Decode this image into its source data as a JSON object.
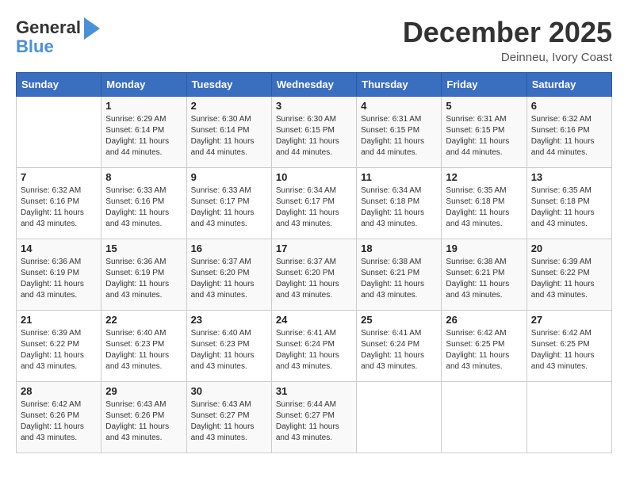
{
  "header": {
    "logo_line1": "General",
    "logo_line2": "Blue",
    "month": "December 2025",
    "location": "Deinneu, Ivory Coast"
  },
  "days_of_week": [
    "Sunday",
    "Monday",
    "Tuesday",
    "Wednesday",
    "Thursday",
    "Friday",
    "Saturday"
  ],
  "weeks": [
    [
      {
        "num": "",
        "sunrise": "",
        "sunset": "",
        "daylight": ""
      },
      {
        "num": "1",
        "sunrise": "Sunrise: 6:29 AM",
        "sunset": "Sunset: 6:14 PM",
        "daylight": "Daylight: 11 hours and 44 minutes."
      },
      {
        "num": "2",
        "sunrise": "Sunrise: 6:30 AM",
        "sunset": "Sunset: 6:14 PM",
        "daylight": "Daylight: 11 hours and 44 minutes."
      },
      {
        "num": "3",
        "sunrise": "Sunrise: 6:30 AM",
        "sunset": "Sunset: 6:15 PM",
        "daylight": "Daylight: 11 hours and 44 minutes."
      },
      {
        "num": "4",
        "sunrise": "Sunrise: 6:31 AM",
        "sunset": "Sunset: 6:15 PM",
        "daylight": "Daylight: 11 hours and 44 minutes."
      },
      {
        "num": "5",
        "sunrise": "Sunrise: 6:31 AM",
        "sunset": "Sunset: 6:15 PM",
        "daylight": "Daylight: 11 hours and 44 minutes."
      },
      {
        "num": "6",
        "sunrise": "Sunrise: 6:32 AM",
        "sunset": "Sunset: 6:16 PM",
        "daylight": "Daylight: 11 hours and 44 minutes."
      }
    ],
    [
      {
        "num": "7",
        "sunrise": "Sunrise: 6:32 AM",
        "sunset": "Sunset: 6:16 PM",
        "daylight": "Daylight: 11 hours and 43 minutes."
      },
      {
        "num": "8",
        "sunrise": "Sunrise: 6:33 AM",
        "sunset": "Sunset: 6:16 PM",
        "daylight": "Daylight: 11 hours and 43 minutes."
      },
      {
        "num": "9",
        "sunrise": "Sunrise: 6:33 AM",
        "sunset": "Sunset: 6:17 PM",
        "daylight": "Daylight: 11 hours and 43 minutes."
      },
      {
        "num": "10",
        "sunrise": "Sunrise: 6:34 AM",
        "sunset": "Sunset: 6:17 PM",
        "daylight": "Daylight: 11 hours and 43 minutes."
      },
      {
        "num": "11",
        "sunrise": "Sunrise: 6:34 AM",
        "sunset": "Sunset: 6:18 PM",
        "daylight": "Daylight: 11 hours and 43 minutes."
      },
      {
        "num": "12",
        "sunrise": "Sunrise: 6:35 AM",
        "sunset": "Sunset: 6:18 PM",
        "daylight": "Daylight: 11 hours and 43 minutes."
      },
      {
        "num": "13",
        "sunrise": "Sunrise: 6:35 AM",
        "sunset": "Sunset: 6:18 PM",
        "daylight": "Daylight: 11 hours and 43 minutes."
      }
    ],
    [
      {
        "num": "14",
        "sunrise": "Sunrise: 6:36 AM",
        "sunset": "Sunset: 6:19 PM",
        "daylight": "Daylight: 11 hours and 43 minutes."
      },
      {
        "num": "15",
        "sunrise": "Sunrise: 6:36 AM",
        "sunset": "Sunset: 6:19 PM",
        "daylight": "Daylight: 11 hours and 43 minutes."
      },
      {
        "num": "16",
        "sunrise": "Sunrise: 6:37 AM",
        "sunset": "Sunset: 6:20 PM",
        "daylight": "Daylight: 11 hours and 43 minutes."
      },
      {
        "num": "17",
        "sunrise": "Sunrise: 6:37 AM",
        "sunset": "Sunset: 6:20 PM",
        "daylight": "Daylight: 11 hours and 43 minutes."
      },
      {
        "num": "18",
        "sunrise": "Sunrise: 6:38 AM",
        "sunset": "Sunset: 6:21 PM",
        "daylight": "Daylight: 11 hours and 43 minutes."
      },
      {
        "num": "19",
        "sunrise": "Sunrise: 6:38 AM",
        "sunset": "Sunset: 6:21 PM",
        "daylight": "Daylight: 11 hours and 43 minutes."
      },
      {
        "num": "20",
        "sunrise": "Sunrise: 6:39 AM",
        "sunset": "Sunset: 6:22 PM",
        "daylight": "Daylight: 11 hours and 43 minutes."
      }
    ],
    [
      {
        "num": "21",
        "sunrise": "Sunrise: 6:39 AM",
        "sunset": "Sunset: 6:22 PM",
        "daylight": "Daylight: 11 hours and 43 minutes."
      },
      {
        "num": "22",
        "sunrise": "Sunrise: 6:40 AM",
        "sunset": "Sunset: 6:23 PM",
        "daylight": "Daylight: 11 hours and 43 minutes."
      },
      {
        "num": "23",
        "sunrise": "Sunrise: 6:40 AM",
        "sunset": "Sunset: 6:23 PM",
        "daylight": "Daylight: 11 hours and 43 minutes."
      },
      {
        "num": "24",
        "sunrise": "Sunrise: 6:41 AM",
        "sunset": "Sunset: 6:24 PM",
        "daylight": "Daylight: 11 hours and 43 minutes."
      },
      {
        "num": "25",
        "sunrise": "Sunrise: 6:41 AM",
        "sunset": "Sunset: 6:24 PM",
        "daylight": "Daylight: 11 hours and 43 minutes."
      },
      {
        "num": "26",
        "sunrise": "Sunrise: 6:42 AM",
        "sunset": "Sunset: 6:25 PM",
        "daylight": "Daylight: 11 hours and 43 minutes."
      },
      {
        "num": "27",
        "sunrise": "Sunrise: 6:42 AM",
        "sunset": "Sunset: 6:25 PM",
        "daylight": "Daylight: 11 hours and 43 minutes."
      }
    ],
    [
      {
        "num": "28",
        "sunrise": "Sunrise: 6:42 AM",
        "sunset": "Sunset: 6:26 PM",
        "daylight": "Daylight: 11 hours and 43 minutes."
      },
      {
        "num": "29",
        "sunrise": "Sunrise: 6:43 AM",
        "sunset": "Sunset: 6:26 PM",
        "daylight": "Daylight: 11 hours and 43 minutes."
      },
      {
        "num": "30",
        "sunrise": "Sunrise: 6:43 AM",
        "sunset": "Sunset: 6:27 PM",
        "daylight": "Daylight: 11 hours and 43 minutes."
      },
      {
        "num": "31",
        "sunrise": "Sunrise: 6:44 AM",
        "sunset": "Sunset: 6:27 PM",
        "daylight": "Daylight: 11 hours and 43 minutes."
      },
      {
        "num": "",
        "sunrise": "",
        "sunset": "",
        "daylight": ""
      },
      {
        "num": "",
        "sunrise": "",
        "sunset": "",
        "daylight": ""
      },
      {
        "num": "",
        "sunrise": "",
        "sunset": "",
        "daylight": ""
      }
    ]
  ]
}
